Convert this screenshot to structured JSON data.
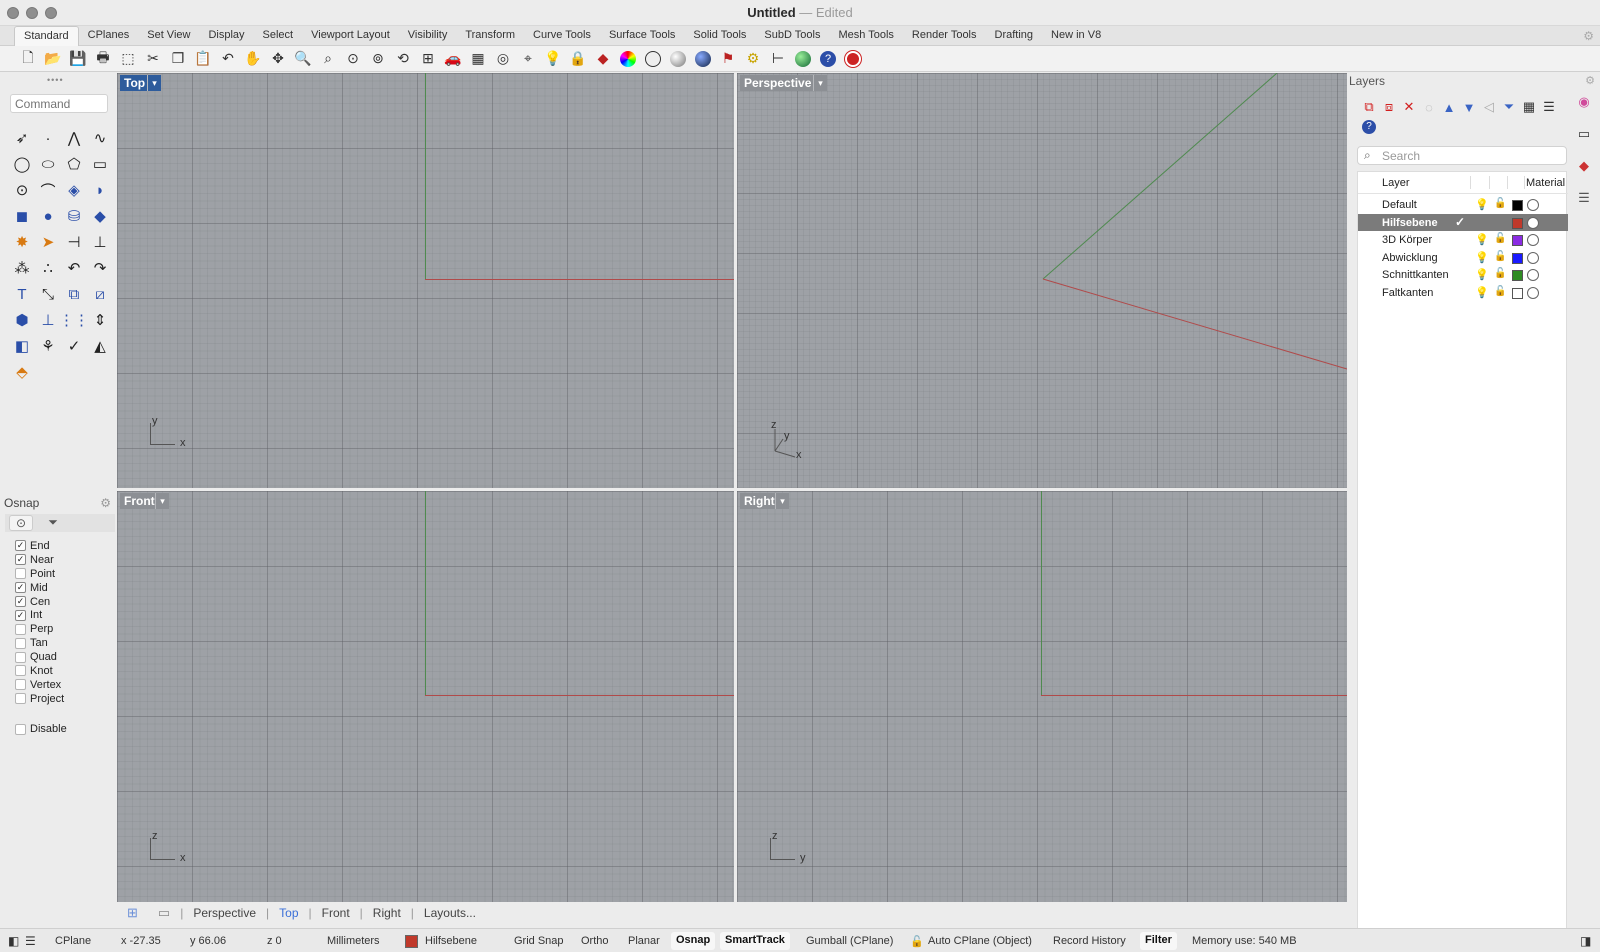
{
  "window": {
    "title": "Untitled",
    "subtitle": "— Edited"
  },
  "menu_tabs": [
    "Standard",
    "CPlanes",
    "Set View",
    "Display",
    "Select",
    "Viewport Layout",
    "Visibility",
    "Transform",
    "Curve Tools",
    "Surface Tools",
    "Solid Tools",
    "SubD Tools",
    "Mesh Tools",
    "Render Tools",
    "Drafting",
    "New in V8"
  ],
  "active_tab": "Standard",
  "toolbar_icons": [
    "new-file-icon",
    "open-icon",
    "save-icon",
    "print-icon",
    "import-icon",
    "cut-icon",
    "copy-icon",
    "paste-icon",
    "undo-icon",
    "pan-hand-icon",
    "rotate-view-icon",
    "zoom-icon",
    "zoom-window-icon",
    "zoom-extents-icon",
    "zoom-selected-icon",
    "rotate-icon",
    "four-viewports-icon",
    "car-icon",
    "grid-plane-icon",
    "snap-icon",
    "analyze-icon",
    "light-bulb-icon",
    "lock-icon",
    "layers-icon",
    "color-wheel-icon",
    "sphere-wire-icon",
    "sphere-shaded-icon",
    "sphere-render-icon",
    "flag-icon",
    "gear-icon",
    "dimension-icon",
    "globe-icon",
    "help-icon",
    "support-icon"
  ],
  "command": {
    "placeholder": "Command"
  },
  "osnap": {
    "title": "Osnap",
    "items": [
      {
        "label": "End",
        "checked": true
      },
      {
        "label": "Near",
        "checked": true
      },
      {
        "label": "Point",
        "checked": false
      },
      {
        "label": "Mid",
        "checked": true
      },
      {
        "label": "Cen",
        "checked": true
      },
      {
        "label": "Int",
        "checked": true
      },
      {
        "label": "Perp",
        "checked": false
      },
      {
        "label": "Tan",
        "checked": false
      },
      {
        "label": "Quad",
        "checked": false
      },
      {
        "label": "Knot",
        "checked": false
      },
      {
        "label": "Vertex",
        "checked": false
      },
      {
        "label": "Project",
        "checked": false
      }
    ],
    "disable_label": "Disable"
  },
  "viewports": {
    "top": {
      "label": "Top",
      "axis1": "y",
      "axis2": "x"
    },
    "perspective": {
      "label": "Perspective",
      "axis1": "z",
      "axis2": "y",
      "axis3": "x"
    },
    "front": {
      "label": "Front",
      "axis1": "z",
      "axis2": "x"
    },
    "right": {
      "label": "Right",
      "axis1": "z",
      "axis2": "y"
    }
  },
  "viewport_tabs": [
    "Perspective",
    "Top",
    "Front",
    "Right",
    "Layouts..."
  ],
  "active_viewport_tab": "Top",
  "layers": {
    "title": "Layers",
    "search_placeholder": "Search",
    "col_layer": "Layer",
    "col_material": "Material",
    "rows": [
      {
        "name": "Default",
        "color": "#000000",
        "selected": false
      },
      {
        "name": "Hilfsebene",
        "color": "#c0392b",
        "selected": true
      },
      {
        "name": "3D Körper",
        "color": "#8a2be2",
        "selected": false
      },
      {
        "name": "Abwicklung",
        "color": "#1a1aff",
        "selected": false
      },
      {
        "name": "Schnittkanten",
        "color": "#2e8b22",
        "selected": false
      },
      {
        "name": "Faltkanten",
        "color": "#ffffff",
        "selected": false
      }
    ]
  },
  "status": {
    "cplane": "CPlane",
    "x": "x -27.35",
    "y": "y 66.06",
    "z": "z 0",
    "units": "Millimeters",
    "layer": "Hilfsebene",
    "layer_color": "#c0392b",
    "grid_snap": "Grid Snap",
    "ortho": "Ortho",
    "planar": "Planar",
    "osnap": "Osnap",
    "smarttrack": "SmartTrack",
    "gumball": "Gumball (CPlane)",
    "autocplane": "Auto CPlane (Object)",
    "record": "Record History",
    "filter": "Filter",
    "memory": "Memory use: 540 MB"
  }
}
